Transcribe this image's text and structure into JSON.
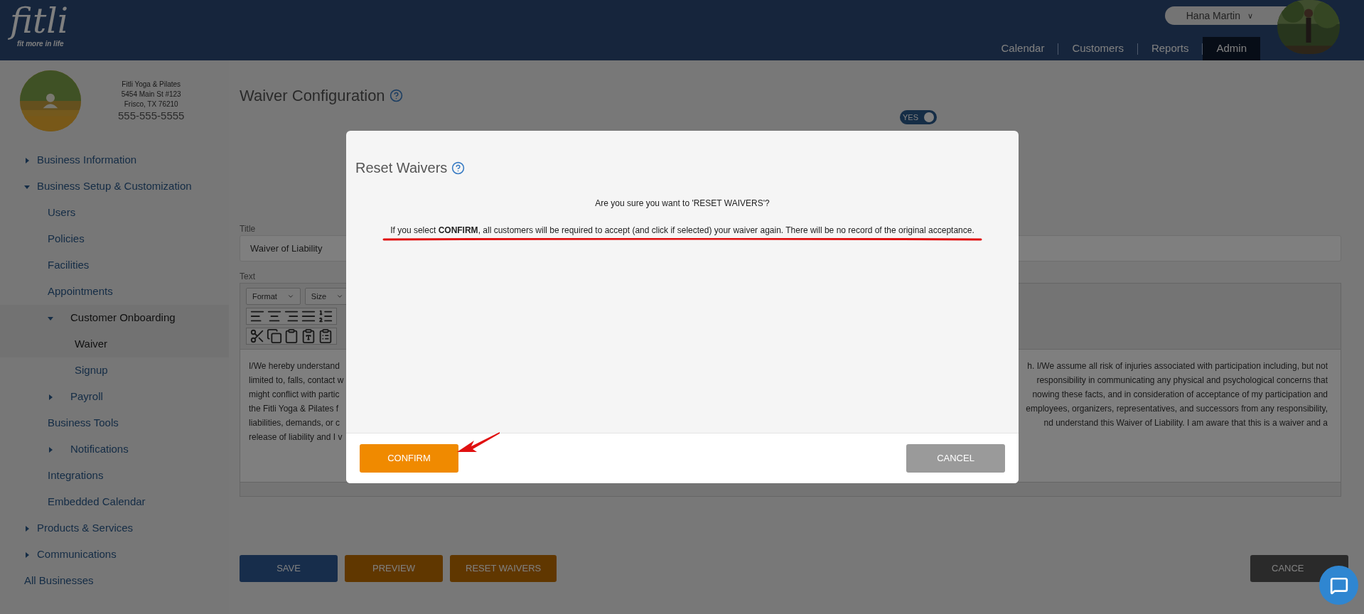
{
  "header": {
    "logo": "fitli",
    "tagline": "fit more in life",
    "user": "Hana Martin",
    "user_caret": "∨",
    "nav": [
      {
        "label": "Calendar",
        "selected": false
      },
      {
        "label": "Customers",
        "selected": false
      },
      {
        "label": "Reports",
        "selected": false
      },
      {
        "label": "Admin",
        "selected": true
      }
    ]
  },
  "business": {
    "name": "Fitli Yoga & Pilates",
    "address": [
      "5454 Main St #123",
      "Frisco, TX 76210"
    ],
    "phone": "555-555-5555"
  },
  "sidebar": {
    "items": [
      {
        "label": "Business Information",
        "kind": "group",
        "expanded": false,
        "selected": false
      },
      {
        "label": "Business Setup & Customization",
        "kind": "group",
        "expanded": true,
        "selected": false,
        "children": [
          {
            "label": "Users",
            "kind": "link",
            "selected": false
          },
          {
            "label": "Policies",
            "kind": "link",
            "selected": false
          },
          {
            "label": "Facilities",
            "kind": "link",
            "selected": false
          },
          {
            "label": "Appointments",
            "kind": "link",
            "selected": false
          },
          {
            "label": "Customer Onboarding",
            "kind": "group",
            "expanded": true,
            "selected": true,
            "children": [
              {
                "label": "Waiver",
                "kind": "link",
                "selected": true
              },
              {
                "label": "Signup",
                "kind": "link",
                "selected": false
              }
            ]
          },
          {
            "label": "Payroll",
            "kind": "group",
            "expanded": false,
            "selected": false
          },
          {
            "label": "Business Tools",
            "kind": "link",
            "selected": false
          },
          {
            "label": "Notifications",
            "kind": "group",
            "expanded": false,
            "selected": false
          },
          {
            "label": "Integrations",
            "kind": "link",
            "selected": false
          },
          {
            "label": "Embedded Calendar",
            "kind": "link",
            "selected": false
          }
        ]
      },
      {
        "label": "Products & Services",
        "kind": "group",
        "expanded": false,
        "selected": false
      },
      {
        "label": "Communications",
        "kind": "group",
        "expanded": false,
        "selected": false
      },
      {
        "label": "All Businesses",
        "kind": "link",
        "selected": false
      }
    ]
  },
  "page": {
    "title": "Waiver Configuration",
    "toggle": {
      "label": "YES",
      "on": true
    },
    "title_field": {
      "label": "Title",
      "value": "Waiver of Liability"
    },
    "editor": {
      "label": "Text",
      "selects": [
        "Format",
        "Size"
      ],
      "lines": [
        {
          "left": "I/We hereby understand",
          "right": "h. I/We assume all risk of injuries associated with participation including, but not"
        },
        {
          "left": "limited to, falls, contact w",
          "right": "responsibility in communicating any physical and psychological concerns that"
        },
        {
          "left": "might conflict with partic",
          "right": "nowing these facts, and in consideration of acceptance of my participation and"
        },
        {
          "left": "the Fitli Yoga & Pilates f",
          "right": "employees, organizers, representatives, and successors from any responsibility,"
        },
        {
          "left": "liabilities, demands, or c",
          "right": "nd understand this Waiver of Liability. I am aware that this is a waiver and a"
        },
        {
          "left": "release of liability and I v"
        }
      ]
    },
    "buttons": [
      {
        "label": "SAVE",
        "kind": "primary"
      },
      {
        "label": "PREVIEW",
        "kind": "warning"
      },
      {
        "label": "RESET WAIVERS",
        "kind": "warning"
      }
    ],
    "cancel": "CANCE"
  },
  "modal": {
    "title": "Reset Waivers",
    "question": "Are you sure you want to 'RESET WAIVERS'?",
    "message": "If you select **CONFIRM**, all customers will be required to accept (and click if selected) your waiver again. There will be no record of the original acceptance.",
    "confirm": "CONFIRM",
    "cancel": "CANCEL"
  }
}
